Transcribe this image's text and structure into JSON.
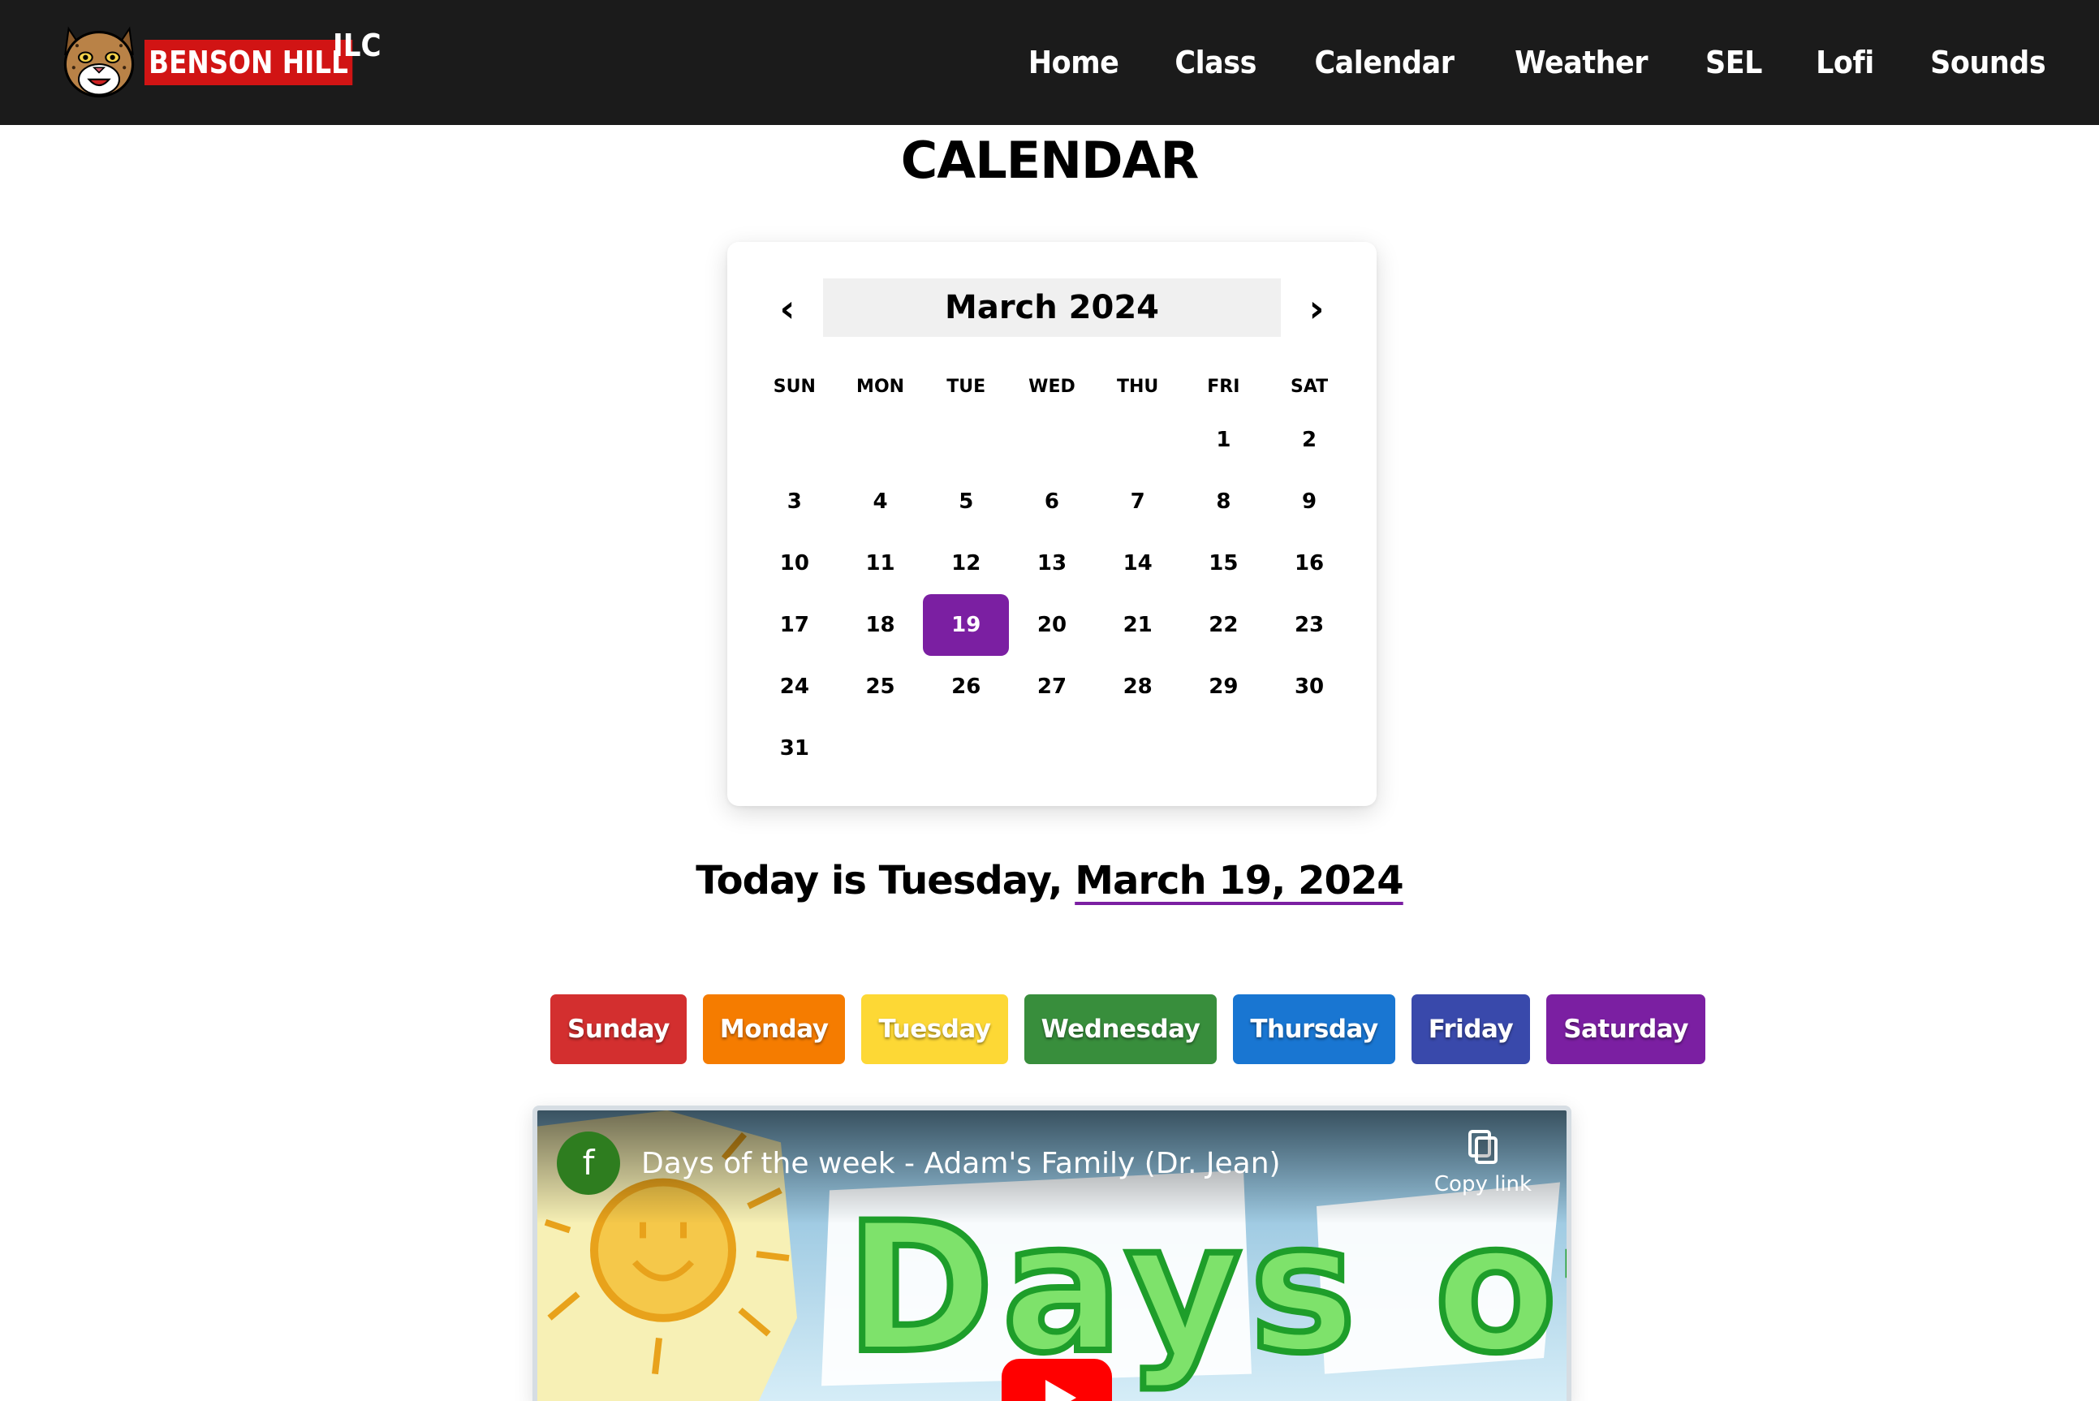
{
  "brand": {
    "name_red": "BENSON HILL",
    "name_suffix": "ILC",
    "logo_icon": "bobcat-mascot-icon"
  },
  "nav": {
    "items": [
      {
        "label": "Home"
      },
      {
        "label": "Class"
      },
      {
        "label": "Calendar"
      },
      {
        "label": "Weather"
      },
      {
        "label": "SEL"
      },
      {
        "label": "Lofi"
      },
      {
        "label": "Sounds"
      }
    ]
  },
  "page_title": "CALENDAR",
  "calendar": {
    "month_label": "March 2024",
    "prev_label": "‹",
    "next_label": "›",
    "weekdays": [
      "SUN",
      "MON",
      "TUE",
      "WED",
      "THU",
      "FRI",
      "SAT"
    ],
    "weeks": [
      [
        "",
        "",
        "",
        "",
        "",
        "1",
        "2"
      ],
      [
        "3",
        "4",
        "5",
        "6",
        "7",
        "8",
        "9"
      ],
      [
        "10",
        "11",
        "12",
        "13",
        "14",
        "15",
        "16"
      ],
      [
        "17",
        "18",
        "19",
        "20",
        "21",
        "22",
        "23"
      ],
      [
        "24",
        "25",
        "26",
        "27",
        "28",
        "29",
        "30"
      ],
      [
        "31",
        "",
        "",
        "",
        "",
        "",
        ""
      ]
    ],
    "today": "19",
    "highlight_color": "#7b1fa2"
  },
  "today_line": {
    "prefix": "Today is Tuesday, ",
    "date": "March 19, 2024"
  },
  "day_buttons": [
    {
      "label": "Sunday",
      "color": "#d32f2f"
    },
    {
      "label": "Monday",
      "color": "#f57c00"
    },
    {
      "label": "Tuesday",
      "color": "#fdd835"
    },
    {
      "label": "Wednesday",
      "color": "#388e3c"
    },
    {
      "label": "Thursday",
      "color": "#1976d2"
    },
    {
      "label": "Friday",
      "color": "#3949ab"
    },
    {
      "label": "Saturday",
      "color": "#7b1fa2"
    }
  ],
  "video": {
    "channel_initial": "f",
    "title": "Days of the week - Adam's Family (Dr. Jean)",
    "copy_label": "Copy link",
    "thumbnail_text": "Days of"
  }
}
